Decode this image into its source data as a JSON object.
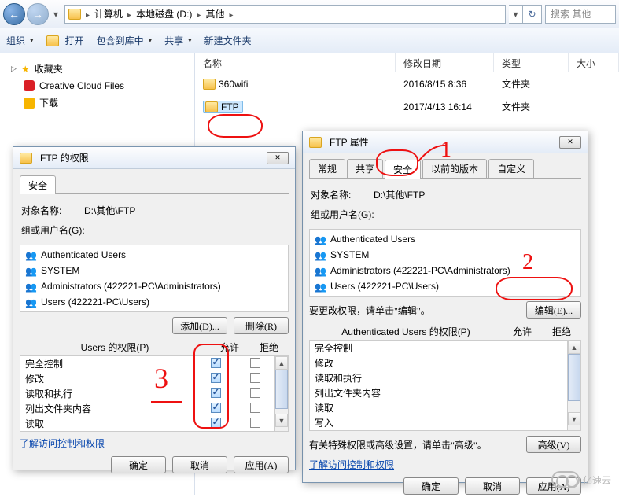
{
  "explorer": {
    "breadcrumb": [
      "计算机",
      "本地磁盘 (D:)",
      "其他"
    ],
    "search_placeholder": "搜索 其他",
    "toolbar": {
      "organize": "组织",
      "open": "打开",
      "include": "包含到库中",
      "share": "共享",
      "newfolder": "新建文件夹"
    },
    "sidebar": {
      "favorites": "收藏夹",
      "ccfiles": "Creative Cloud Files",
      "downloads": "下载"
    },
    "columns": {
      "name": "名称",
      "date": "修改日期",
      "type": "类型",
      "size": "大小"
    },
    "rows": [
      {
        "name": "360wifi",
        "date": "2016/8/15 8:36",
        "type": "文件夹"
      },
      {
        "name": "FTP",
        "date": "2017/4/13 16:14",
        "type": "文件夹"
      }
    ]
  },
  "dlg_perm": {
    "title": "FTP 的权限",
    "tab_security": "安全",
    "object_label": "对象名称:",
    "object_value": "D:\\其他\\FTP",
    "groups_label": "组或用户名(G):",
    "groups": [
      "Authenticated Users",
      "SYSTEM",
      "Administrators (422221-PC\\Administrators)",
      "Users (422221-PC\\Users)"
    ],
    "add_btn": "添加(D)...",
    "remove_btn": "删除(R)",
    "perm_for": "Users 的权限(P)",
    "col_allow": "允许",
    "col_deny": "拒绝",
    "perms": [
      {
        "name": "完全控制",
        "allow": true,
        "deny": false
      },
      {
        "name": "修改",
        "allow": true,
        "deny": false
      },
      {
        "name": "读取和执行",
        "allow": true,
        "deny": false
      },
      {
        "name": "列出文件夹内容",
        "allow": true,
        "deny": false
      },
      {
        "name": "读取",
        "allow": true,
        "deny": false
      }
    ],
    "learn_link": "了解访问控制和权限",
    "ok": "确定",
    "cancel": "取消",
    "apply": "应用(A)"
  },
  "dlg_prop": {
    "title": "FTP 属性",
    "tabs": {
      "general": "常规",
      "share": "共享",
      "security": "安全",
      "prev": "以前的版本",
      "custom": "自定义"
    },
    "object_label": "对象名称:",
    "object_value": "D:\\其他\\FTP",
    "groups_label": "组或用户名(G):",
    "groups": [
      "Authenticated Users",
      "SYSTEM",
      "Administrators (422221-PC\\Administrators)",
      "Users (422221-PC\\Users)"
    ],
    "edit_hint": "要更改权限，请单击\"编辑\"。",
    "edit_btn": "编辑(E)...",
    "perm_for": "Authenticated Users 的权限(P)",
    "col_allow": "允许",
    "col_deny": "拒绝",
    "perms": [
      "完全控制",
      "修改",
      "读取和执行",
      "列出文件夹内容",
      "读取",
      "写入"
    ],
    "adv_hint": "有关特殊权限或高级设置，请单击\"高级\"。",
    "adv_btn": "高级(V)",
    "learn_link": "了解访问控制和权限",
    "ok": "确定",
    "cancel": "取消",
    "apply": "应用(A)"
  },
  "watermark": "亿速云"
}
